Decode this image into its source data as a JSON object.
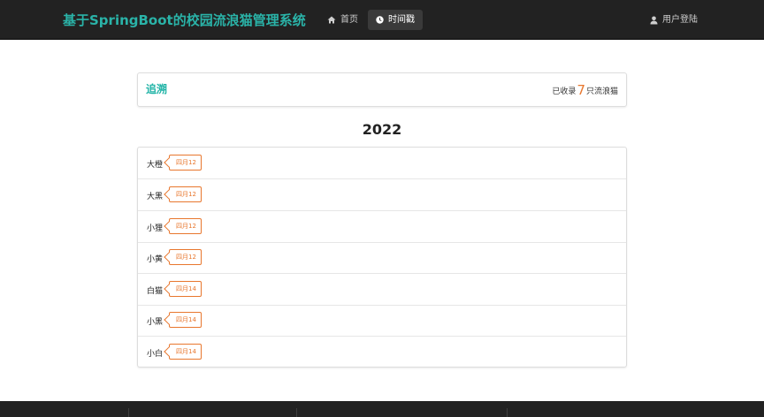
{
  "navbar": {
    "brand": "基于SpringBoot的校园流浪猫管理系统",
    "home_label": "首页",
    "timeline_label": "时间戳",
    "login_label": "用户登陆",
    "icons": {
      "home": "home-icon",
      "timeline": "clock-icon",
      "login": "user-icon"
    }
  },
  "header_panel": {
    "title": "追溯",
    "count_prefix": "已收录",
    "count": "7",
    "count_suffix": "只流浪猫"
  },
  "year": "2022",
  "cats": [
    {
      "name": "大橙",
      "date": "四月12"
    },
    {
      "name": "大黑",
      "date": "四月12"
    },
    {
      "name": "小狸",
      "date": "四月12"
    },
    {
      "name": "小黄",
      "date": "四月12"
    },
    {
      "name": "白猫",
      "date": "四月14"
    },
    {
      "name": "小黑",
      "date": "四月14"
    },
    {
      "name": "小白",
      "date": "四月14"
    }
  ],
  "colors": {
    "brand": "#2ab3a8",
    "accent": "#e8772e",
    "nav_bg": "#222222"
  }
}
